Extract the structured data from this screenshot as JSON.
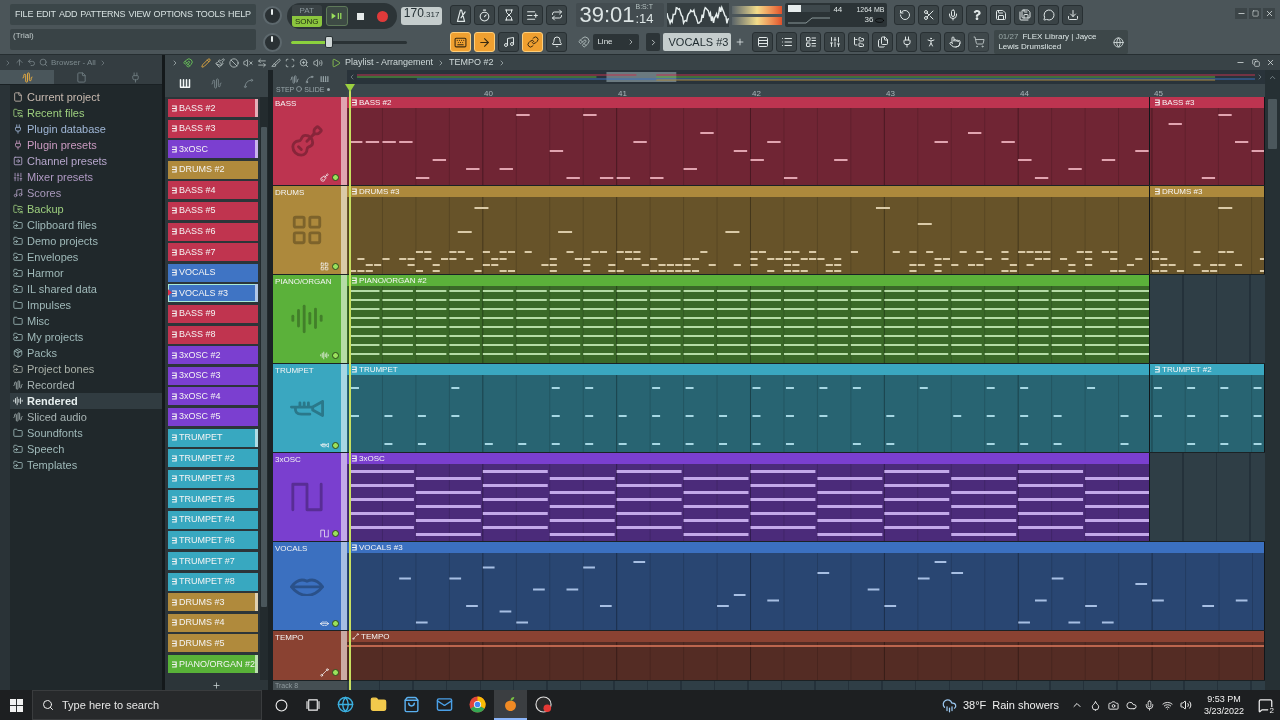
{
  "toolbar": {
    "menu": [
      "FILE",
      "EDIT",
      "ADD",
      "PATTERNS",
      "VIEW",
      "OPTIONS",
      "TOOLS",
      "HELP"
    ],
    "hint": "(Trial)",
    "mode": [
      {
        "label": "PAT",
        "selected": false
      },
      {
        "label": "SONG",
        "selected": true
      }
    ],
    "tempo": {
      "whole": "170",
      "fraction": ".317"
    },
    "time": {
      "main": "39:01",
      "ticks": ":14",
      "format": "B:S:T"
    },
    "resources": {
      "level": 0.3,
      "cpu": "44",
      "memory": "1264 MB",
      "polyphony": "36"
    },
    "master_volume": {
      "level": 0.33
    },
    "toggles": [
      {
        "kind": "keyboard",
        "on": true
      },
      {
        "kind": "arrow",
        "on": true
      },
      {
        "kind": "note",
        "on": false
      },
      {
        "kind": "link",
        "on": true
      },
      {
        "kind": "bell",
        "on": false
      }
    ],
    "snap": "Line",
    "pattern": "VOCALS #3",
    "news": {
      "counter": "01/27",
      "headline": "FLEX Library | Jayce Lewis Drumsliced"
    }
  },
  "browser": {
    "title": "Browser - All",
    "tabs": [
      {
        "kind": "audio",
        "selected": true
      },
      {
        "kind": "files",
        "selected": false
      },
      {
        "kind": "plugins",
        "selected": false
      }
    ],
    "items": [
      {
        "label": "Current project",
        "kind": "project",
        "color": "#c8bab0",
        "selected": false
      },
      {
        "label": "Recent files",
        "kind": "recent",
        "color": "#9dcf7e",
        "selected": false
      },
      {
        "label": "Plugin database",
        "kind": "plugin",
        "color": "#9fb6d6",
        "selected": false
      },
      {
        "label": "Plugin presets",
        "kind": "plugin",
        "color": "#c99ac0",
        "selected": false
      },
      {
        "label": "Channel presets",
        "kind": "channel",
        "color": "#b6a6cc",
        "selected": false
      },
      {
        "label": "Mixer presets",
        "kind": "mixer",
        "color": "#b09ac4",
        "selected": false
      },
      {
        "label": "Scores",
        "kind": "score",
        "color": "#a99abc",
        "selected": false
      },
      {
        "label": "Backup",
        "kind": "recent",
        "color": "#9dcf7e",
        "selected": false
      },
      {
        "label": "Clipboard files",
        "kind": "link",
        "color": "#9fb9b9",
        "selected": false
      },
      {
        "label": "Demo projects",
        "kind": "link",
        "color": "#9fb9b9",
        "selected": false
      },
      {
        "label": "Envelopes",
        "kind": "link",
        "color": "#9fb9b9",
        "selected": false
      },
      {
        "label": "Harmor",
        "kind": "link",
        "color": "#9fb9b9",
        "selected": false
      },
      {
        "label": "IL shared data",
        "kind": "link",
        "color": "#9fb9b9",
        "selected": false
      },
      {
        "label": "Impulses",
        "kind": "folder",
        "color": "#9fb9b9",
        "selected": false
      },
      {
        "label": "Misc",
        "kind": "folder",
        "color": "#9fb9b9",
        "selected": false
      },
      {
        "label": "My projects",
        "kind": "link",
        "color": "#9fb9b9",
        "selected": false
      },
      {
        "label": "Packs",
        "kind": "packs",
        "color": "#9fb9b9",
        "selected": false
      },
      {
        "label": "Project bones",
        "kind": "link",
        "color": "#a9b0a8",
        "selected": false
      },
      {
        "label": "Recorded",
        "kind": "audio",
        "color": "#a8b4b4",
        "selected": false
      },
      {
        "label": "Rendered",
        "kind": "rendered",
        "color": "#e8f0f0",
        "selected": true
      },
      {
        "label": "Sliced audio",
        "kind": "audio",
        "color": "#a8b4b4",
        "selected": false
      },
      {
        "label": "Soundfonts",
        "kind": "folder",
        "color": "#9fb9b9",
        "selected": false
      },
      {
        "label": "Speech",
        "kind": "link",
        "color": "#9fb9b9",
        "selected": false
      },
      {
        "label": "Templates",
        "kind": "link",
        "color": "#9fb9b9",
        "selected": false
      }
    ]
  },
  "playlist": {
    "title": "Playlist - Arrangement",
    "breadcrumb": "TEMPO #2",
    "picker_tabs": [
      {
        "kind": "patterns",
        "selected": true
      },
      {
        "kind": "audio",
        "selected": false
      },
      {
        "kind": "automation",
        "selected": false
      }
    ],
    "patterns": [
      {
        "name": "BASS #2",
        "color": "#c0344f",
        "selected": false,
        "marked": true
      },
      {
        "name": "BASS #3",
        "color": "#c0344f",
        "selected": false,
        "marked": false
      },
      {
        "name": "3xOSC",
        "color": "#7b3fd0",
        "selected": false,
        "marked": true
      },
      {
        "name": "DRUMS #2",
        "color": "#b08a3c",
        "selected": false,
        "marked": false
      },
      {
        "name": "BASS #4",
        "color": "#c0344f",
        "selected": false,
        "marked": false
      },
      {
        "name": "BASS #5",
        "color": "#c0344f",
        "selected": false,
        "marked": false
      },
      {
        "name": "BASS #6",
        "color": "#c0344f",
        "selected": false,
        "marked": false
      },
      {
        "name": "BASS #7",
        "color": "#c0344f",
        "selected": false,
        "marked": false
      },
      {
        "name": "VOCALS",
        "color": "#3f74c4",
        "selected": false,
        "marked": false
      },
      {
        "name": "VOCALS #3",
        "color": "#3f74c4",
        "selected": true,
        "marked": true
      },
      {
        "name": "BASS #9",
        "color": "#c0344f",
        "selected": false,
        "marked": false
      },
      {
        "name": "BASS #8",
        "color": "#c0344f",
        "selected": false,
        "marked": false
      },
      {
        "name": "3xOSC #2",
        "color": "#7b3fd0",
        "selected": false,
        "marked": false
      },
      {
        "name": "3xOSC #3",
        "color": "#7b3fd0",
        "selected": false,
        "marked": false
      },
      {
        "name": "3xOSC #4",
        "color": "#7b3fd0",
        "selected": false,
        "marked": false
      },
      {
        "name": "3xOSC #5",
        "color": "#7b3fd0",
        "selected": false,
        "marked": false
      },
      {
        "name": "TRUMPET",
        "color": "#38a8c0",
        "selected": false,
        "marked": true
      },
      {
        "name": "TRUMPET #2",
        "color": "#38a8c0",
        "selected": false,
        "marked": false
      },
      {
        "name": "TRUMPET #3",
        "color": "#38a8c0",
        "selected": false,
        "marked": false
      },
      {
        "name": "TRUMPET #5",
        "color": "#38a8c0",
        "selected": false,
        "marked": false
      },
      {
        "name": "TRUMPET #4",
        "color": "#38a8c0",
        "selected": false,
        "marked": false
      },
      {
        "name": "TRUMPET #6",
        "color": "#38a8c0",
        "selected": false,
        "marked": false
      },
      {
        "name": "TRUMPET #7",
        "color": "#38a8c0",
        "selected": false,
        "marked": false
      },
      {
        "name": "TRUMPET #8",
        "color": "#38a8c0",
        "selected": false,
        "marked": false
      },
      {
        "name": "DRUMS #3",
        "color": "#b08a3c",
        "selected": false,
        "marked": true
      },
      {
        "name": "DRUMS #4",
        "color": "#b08a3c",
        "selected": false,
        "marked": false
      },
      {
        "name": "DRUMS #5",
        "color": "#b08a3c",
        "selected": false,
        "marked": false
      },
      {
        "name": "PIANO/ORGAN #2",
        "color": "#58b238",
        "selected": false,
        "marked": true
      }
    ],
    "options": [
      "STEP",
      "SLIDE"
    ],
    "ruler": [
      "40",
      "41",
      "42",
      "43",
      "44",
      "45"
    ],
    "tracks": [
      {
        "name": "BASS",
        "color": "#bd3450",
        "kind": "bass",
        "active": true,
        "clips": [
          {
            "label": "BASS #2",
            "kind": "main"
          },
          {
            "label": "BASS #3",
            "kind": "tail"
          }
        ]
      },
      {
        "name": "DRUMS",
        "color": "#ad893c",
        "kind": "drums",
        "active": true,
        "clips": [
          {
            "label": "DRUMS #3",
            "kind": "main"
          },
          {
            "label": "DRUMS #3",
            "kind": "tail"
          }
        ]
      },
      {
        "name": "PIANO/ORGAN",
        "color": "#5bb13a",
        "kind": "keys",
        "active": true,
        "clips": [
          {
            "label": "PIANO/ORGAN #2",
            "kind": "main"
          }
        ]
      },
      {
        "name": "TRUMPET",
        "color": "#3aa7c0",
        "kind": "brass",
        "active": true,
        "clips": [
          {
            "label": "TRUMPET",
            "kind": "main"
          },
          {
            "label": "TRUMPET #2",
            "kind": "tail"
          }
        ]
      },
      {
        "name": "3xOSC",
        "color": "#7a3fcf",
        "kind": "synth",
        "active": true,
        "clips": [
          {
            "label": "3xOSC",
            "kind": "main"
          }
        ]
      },
      {
        "name": "VOCALS",
        "color": "#3b70c0",
        "kind": "voice",
        "active": true,
        "clips": [
          {
            "label": "VOCALS #3",
            "kind": "full"
          }
        ]
      },
      {
        "name": "TEMPO",
        "color": "#8a4232",
        "kind": "automation",
        "active": true,
        "clips": [
          {
            "label": "TEMPO",
            "kind": "full"
          }
        ]
      }
    ],
    "next_track": "Track 8"
  },
  "taskbar": {
    "search": {
      "placeholder": "Type here to search"
    },
    "apps": [
      {
        "kind": "globe",
        "active": false
      },
      {
        "kind": "folder",
        "active": false
      },
      {
        "kind": "store",
        "active": false
      },
      {
        "kind": "mail",
        "active": false
      },
      {
        "kind": "circle",
        "active": false
      },
      {
        "kind": "fruit",
        "active": true
      },
      {
        "kind": "record",
        "active": false
      }
    ],
    "weather": {
      "temperature": "38°F",
      "condition": "Rain showers"
    },
    "clock": {
      "time": "9:53 PM",
      "date": "3/23/2022"
    },
    "notifications": "2"
  }
}
